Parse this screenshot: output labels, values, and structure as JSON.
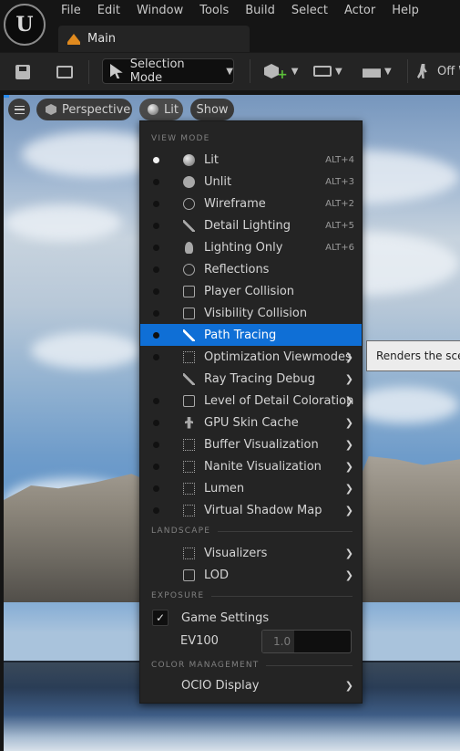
{
  "menubar": {
    "items": [
      "File",
      "Edit",
      "Window",
      "Tools",
      "Build",
      "Select",
      "Actor",
      "Help"
    ]
  },
  "tab": {
    "label": "Main",
    "icon": "level-icon"
  },
  "toolbar": {
    "selection_mode": "Selection Mode",
    "play_label": "Off W",
    "icons": [
      "save-icon",
      "content-browser-icon",
      "add-actor-icon",
      "blueprint-icon",
      "cinematics-icon",
      "play-icon"
    ]
  },
  "viewport": {
    "perspective_label": "Perspective",
    "lit_label": "Lit",
    "show_label": "Show"
  },
  "menu": {
    "view_mode_header": "VIEW MODE",
    "view_modes": [
      {
        "label": "Lit",
        "shortcut": "ALT+4",
        "icon": "sphere-icon",
        "radio": "selected",
        "submenu": false
      },
      {
        "label": "Unlit",
        "shortcut": "ALT+3",
        "icon": "flat-sphere-icon",
        "radio": "off",
        "submenu": false
      },
      {
        "label": "Wireframe",
        "shortcut": "ALT+2",
        "icon": "wireframe-icon",
        "radio": "off",
        "submenu": false
      },
      {
        "label": "Detail Lighting",
        "shortcut": "ALT+5",
        "icon": "detail-lighting-icon",
        "radio": "off",
        "submenu": false
      },
      {
        "label": "Lighting Only",
        "shortcut": "ALT+6",
        "icon": "bulb-icon",
        "radio": "off",
        "submenu": false
      },
      {
        "label": "Reflections",
        "shortcut": "",
        "icon": "reflections-icon",
        "radio": "off",
        "submenu": false
      },
      {
        "label": "Player Collision",
        "shortcut": "",
        "icon": "player-collision-icon",
        "radio": "off",
        "submenu": false
      },
      {
        "label": "Visibility Collision",
        "shortcut": "",
        "icon": "visibility-collision-icon",
        "radio": "off",
        "submenu": false
      },
      {
        "label": "Path Tracing",
        "shortcut": "",
        "icon": "path-tracing-icon",
        "radio": "off",
        "submenu": false,
        "highlighted": true
      },
      {
        "label": "Optimization Viewmodes",
        "shortcut": "",
        "icon": "grid-icon",
        "radio": "off",
        "submenu": true
      },
      {
        "label": "Ray Tracing Debug",
        "shortcut": "",
        "icon": "ray-tracing-icon",
        "radio": "none",
        "submenu": true
      },
      {
        "label": "Level of Detail Coloration",
        "shortcut": "",
        "icon": "lod-icon",
        "radio": "off",
        "submenu": true
      },
      {
        "label": "GPU Skin Cache",
        "shortcut": "",
        "icon": "skin-cache-icon",
        "radio": "off",
        "submenu": true
      },
      {
        "label": "Buffer Visualization",
        "shortcut": "",
        "icon": "grid-icon",
        "radio": "off",
        "submenu": true
      },
      {
        "label": "Nanite Visualization",
        "shortcut": "",
        "icon": "grid-icon",
        "radio": "off",
        "submenu": true
      },
      {
        "label": "Lumen",
        "shortcut": "",
        "icon": "grid-icon",
        "radio": "off",
        "submenu": true
      },
      {
        "label": "Virtual Shadow Map",
        "shortcut": "",
        "icon": "grid-icon",
        "radio": "off",
        "submenu": true
      }
    ],
    "landscape_header": "LANDSCAPE",
    "landscape_items": [
      {
        "label": "Visualizers",
        "icon": "visualizers-icon",
        "submenu": true
      },
      {
        "label": "LOD",
        "icon": "lod-icon",
        "submenu": true
      }
    ],
    "exposure_header": "EXPOSURE",
    "game_settings_label": "Game Settings",
    "game_settings_checked": true,
    "ev100_label": "EV100",
    "ev100_value": "1.0",
    "color_header": "COLOR MANAGEMENT",
    "ocio_label": "OCIO Display"
  },
  "tooltip": {
    "text": "Renders the scen"
  },
  "colors": {
    "highlight": "#0f6fd6",
    "menu_bg": "#242424",
    "accent_orange": "#e08a1e"
  }
}
